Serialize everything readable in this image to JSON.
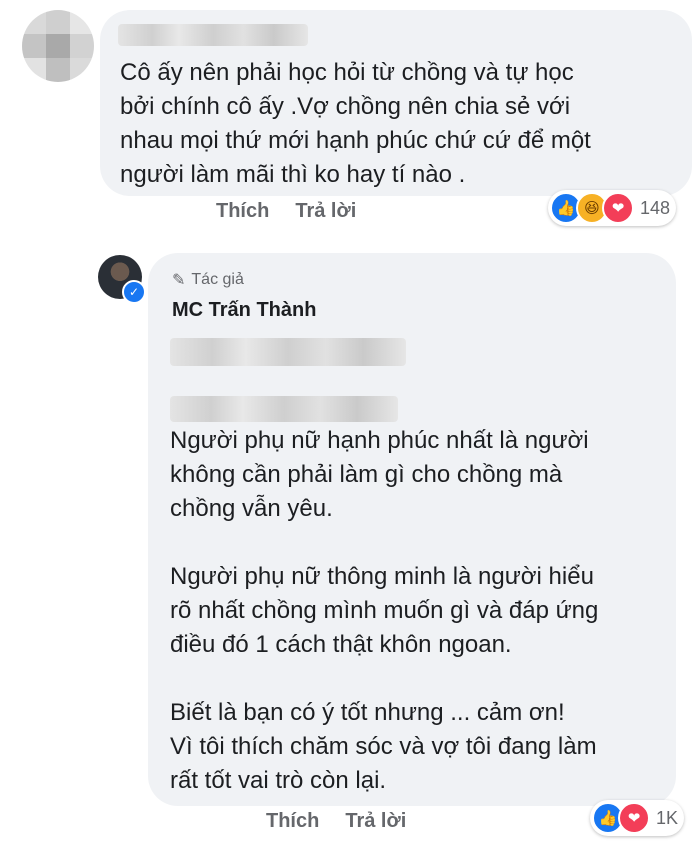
{
  "comment1": {
    "text": "Cô ấy nên phải học hỏi từ chồng và tự học\nbởi chính cô ấy .Vợ chồng nên chia sẻ với\nnhau mọi thứ mới hạnh phúc chứ cứ để một\nngười làm mãi thì ko hay tí nào .",
    "actions": {
      "like": "Thích",
      "reply": "Trả lời"
    },
    "reactions": {
      "icons": [
        "like",
        "haha",
        "love"
      ],
      "count": "148"
    }
  },
  "reply": {
    "badge": "Tác giả",
    "author": "MC Trấn Thành",
    "text": "Người phụ nữ hạnh phúc nhất là người\nkhông cần phải làm gì cho chồng mà\nchồng vẫn yêu.\n\nNgười phụ nữ thông minh là người hiểu\nrõ nhất chồng mình muốn gì và đáp ứng\nđiều đó 1 cách thật khôn ngoan.\n\nBiết là bạn có ý tốt nhưng ... cảm ơn!\nVì tôi thích chăm sóc và vợ tôi đang làm\nrất tốt vai trò còn lại.",
    "actions": {
      "like": "Thích",
      "reply": "Trả lời"
    },
    "reactions": {
      "icons": [
        "like",
        "love"
      ],
      "count": "1K"
    }
  },
  "icons": {
    "like": "👍",
    "haha": "😆",
    "love": "❤",
    "pencil": "✎",
    "check": "✓"
  },
  "colors": {
    "bubble": "#f0f2f5",
    "action": "#65676b",
    "like": "#1877f2",
    "love": "#f33e58",
    "haha": "#f7b125"
  }
}
